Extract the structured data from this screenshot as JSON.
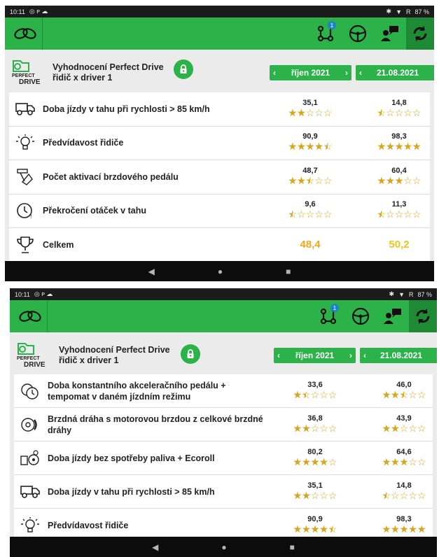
{
  "screen1": {
    "status": {
      "time": "10:11",
      "battery": "87 %",
      "signal": "R"
    },
    "header": {
      "title": "Vyhodnocení Perfect Drive",
      "subtitle": "řidič x driver 1"
    },
    "period1": {
      "label": "říjen 2021"
    },
    "period2": {
      "label": "21.08.2021"
    },
    "badge_count": "1",
    "rows": [
      {
        "label": "Doba jízdy v tahu při rychlosti > 85 km/h",
        "icon": "truck-icon",
        "v1": "35,1",
        "s1": 2,
        "v2": "14,8",
        "s2": 0.5
      },
      {
        "label": "Předvídavost řidiče",
        "icon": "bulb-icon",
        "v1": "90,9",
        "s1": 4.5,
        "v2": "98,3",
        "s2": 5
      },
      {
        "label": "Počet aktivací brzdového pedálu",
        "icon": "pedal-icon",
        "v1": "48,7",
        "s1": 2.5,
        "v2": "60,4",
        "s2": 3
      },
      {
        "label": "Překročení otáček v tahu",
        "icon": "clock-alert-icon",
        "v1": "9,6",
        "s1": 0.5,
        "v2": "11,3",
        "s2": 0.5
      },
      {
        "label": "Celkem",
        "icon": "trophy-icon",
        "total1": "48,4",
        "total2": "50,2"
      }
    ]
  },
  "screen2": {
    "status": {
      "time": "10:11",
      "battery": "87 %",
      "signal": "R"
    },
    "header": {
      "title": "Vyhodnocení Perfect Drive",
      "subtitle": "řidič x driver 1"
    },
    "period1": {
      "label": "říjen 2021"
    },
    "period2": {
      "label": "21.08.2021"
    },
    "badge_count": "1",
    "rows": [
      {
        "label": "Doba konstantního akceleračního pedálu +",
        "label2": "tempomat v daném jízdním režimu",
        "icon": "speed-clock-icon",
        "v1": "33,6",
        "s1": 1.5,
        "v2": "46,0",
        "s2": 2.5
      },
      {
        "label": "Brzdná dráha s motorovou brzdou z celkové brzdné",
        "label2": "dráhy",
        "icon": "brake-disc-icon",
        "v1": "36,8",
        "s1": 2,
        "v2": "43,9",
        "s2": 2
      },
      {
        "label": "Doba jízdy bez spotřeby paliva + Ecoroll",
        "icon": "fuel-icon",
        "v1": "80,2",
        "s1": 4,
        "v2": "64,6",
        "s2": 3
      },
      {
        "label": "Doba jízdy v tahu při rychlosti > 85 km/h",
        "icon": "truck-icon",
        "v1": "35,1",
        "s1": 2,
        "v2": "14,8",
        "s2": 0.5
      },
      {
        "label": "Předvídavost řidiče",
        "icon": "bulb-icon",
        "v1": "90,9",
        "s1": 4.5,
        "v2": "98,3",
        "s2": 5
      }
    ]
  },
  "brand": {
    "logo_text_1": "PERFECT",
    "logo_text_2": "DRIVE"
  },
  "colors": {
    "accent": "#2bb34a",
    "star": "#d9a51a",
    "total": "#f1c21b"
  }
}
